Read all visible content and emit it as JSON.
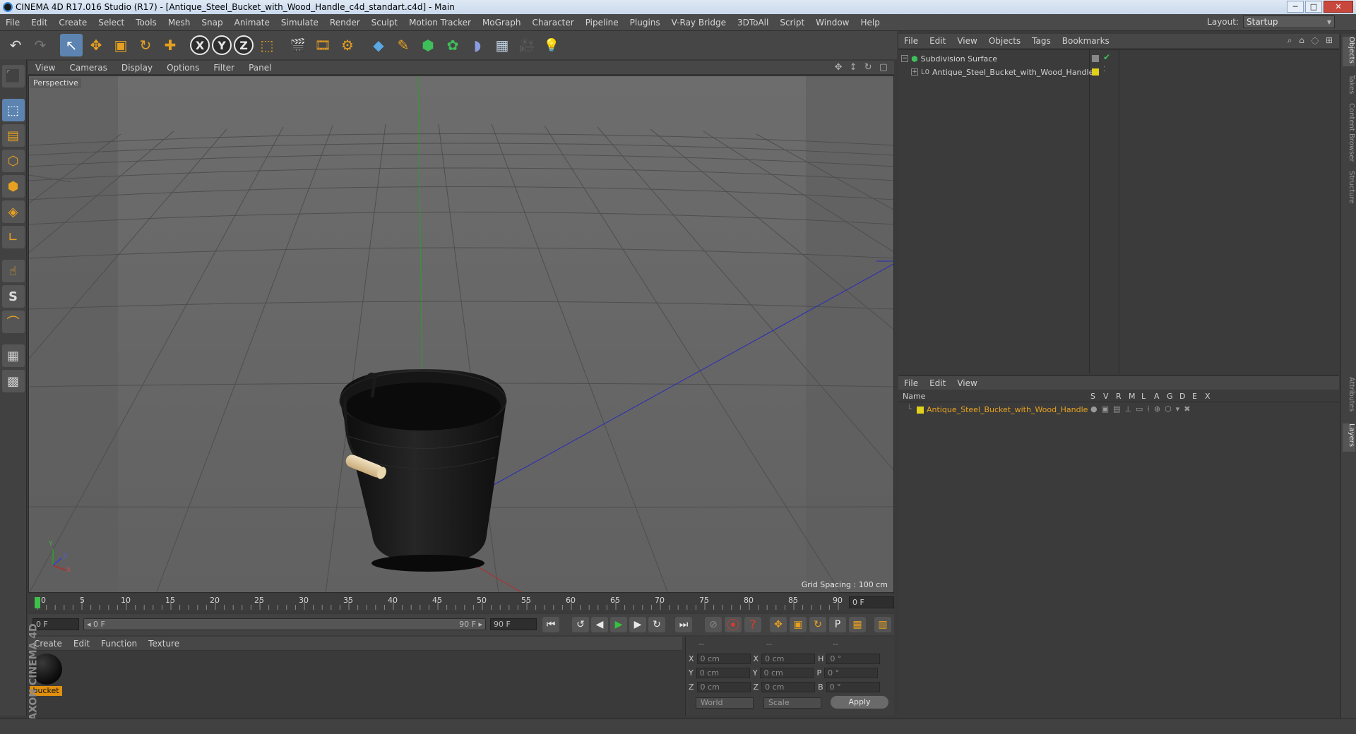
{
  "window": {
    "title": "CINEMA 4D R17.016 Studio (R17) - [Antique_Steel_Bucket_with_Wood_Handle_c4d_standart.c4d] - Main",
    "minimize": "─",
    "maximize": "□",
    "close": "✕"
  },
  "menu": [
    "File",
    "Edit",
    "Create",
    "Select",
    "Tools",
    "Mesh",
    "Snap",
    "Animate",
    "Simulate",
    "Render",
    "Sculpt",
    "Motion Tracker",
    "MoGraph",
    "Character",
    "Pipeline",
    "Plugins",
    "V-Ray Bridge",
    "3DToAll",
    "Script",
    "Window",
    "Help"
  ],
  "layout": {
    "label": "Layout:",
    "value": "Startup"
  },
  "toolbar": {
    "undo": "↶",
    "redo": "↷",
    "select": "↖",
    "move": "✥",
    "scale": "▣",
    "rotate": "↻",
    "plus": "✚",
    "axis_x": "X",
    "axis_y": "Y",
    "axis_z": "Z",
    "coord": "⬚",
    "render_view": "🎬",
    "render_pic": "🎞",
    "render_settings": "⚙",
    "cube": "◆",
    "pen": "✎",
    "nurbs": "⬢",
    "mograph": "✿",
    "deformer": "◗",
    "scene": "▦",
    "camera": "🎥",
    "light": "💡"
  },
  "lefttools": [
    "⬛",
    "⬚",
    "▤",
    "⬡",
    "⬢",
    "◈",
    "∟",
    "☝",
    "S",
    "⌒",
    "▦",
    "▩"
  ],
  "viewport": {
    "menu": [
      "View",
      "Cameras",
      "Display",
      "Options",
      "Filter",
      "Panel"
    ],
    "nav_icons": "✥ ↕ ↻ ▢",
    "label": "Perspective",
    "grid_spacing": "Grid Spacing : 100 cm",
    "axis_y": "Y",
    "axis_x": "X",
    "axis_z": "Z"
  },
  "timeline": {
    "ticks": [
      "0",
      "5",
      "10",
      "15",
      "20",
      "25",
      "30",
      "35",
      "40",
      "45",
      "50",
      "55",
      "60",
      "65",
      "70",
      "75",
      "80",
      "85",
      "90"
    ],
    "current_frame": "0 F"
  },
  "playbar": {
    "start": "0 F",
    "range_start": "◂ 0 F",
    "range_end": "90 F ▸",
    "end": "90 F",
    "buttons": [
      "⏮",
      "↺",
      "◀",
      "▶",
      "▶",
      "↻",
      "⏭"
    ],
    "rec": [
      "⊘",
      "⦿",
      "?",
      "✥",
      "▣",
      "↻",
      "P",
      "▦",
      "▥"
    ]
  },
  "materials": {
    "menu": [
      "Create",
      "Edit",
      "Function",
      "Texture"
    ],
    "items": [
      {
        "name": "bucket"
      }
    ]
  },
  "branding": "MAXON CINEMA 4D",
  "coordinates": {
    "headers": [
      "--",
      "--",
      "--"
    ],
    "rows": [
      {
        "a": "X",
        "av": "0 cm",
        "b": "X",
        "bv": "0 cm",
        "c": "H",
        "cv": "0 °"
      },
      {
        "a": "Y",
        "av": "0 cm",
        "b": "Y",
        "bv": "0 cm",
        "c": "P",
        "cv": "0 °"
      },
      {
        "a": "Z",
        "av": "0 cm",
        "b": "Z",
        "bv": "0 cm",
        "c": "B",
        "cv": "0 °"
      }
    ],
    "space": "World",
    "mode": "Scale",
    "apply": "Apply"
  },
  "objects": {
    "menu": [
      "File",
      "Edit",
      "View",
      "Objects",
      "Tags",
      "Bookmarks"
    ],
    "icons": "⌕ ⌂ ◌ ⊞",
    "items": [
      {
        "name": "Subdivision Surface",
        "level": 0,
        "expand": "−"
      },
      {
        "name": "Antique_Steel_Bucket_with_Wood_Handle",
        "level": 1,
        "expand": "+"
      }
    ]
  },
  "layers": {
    "menu": [
      "File",
      "Edit",
      "View"
    ],
    "columns": [
      "Name",
      "S",
      "V",
      "R",
      "M",
      "L",
      "A",
      "G",
      "D",
      "E",
      "X"
    ],
    "items": [
      {
        "name": "Antique_Steel_Bucket_with_Wood_Handle"
      }
    ]
  },
  "right_tabs": [
    "Objects",
    "Takes",
    "Content Browser",
    "Structure",
    "Attributes",
    "Layers"
  ],
  "colors": {
    "accent_orange": "#e7a020",
    "layer_yellow": "#e0d21a",
    "axis_green": "#2aa02a",
    "axis_blue": "#2b2bb8",
    "axis_red": "#b52b2b"
  }
}
